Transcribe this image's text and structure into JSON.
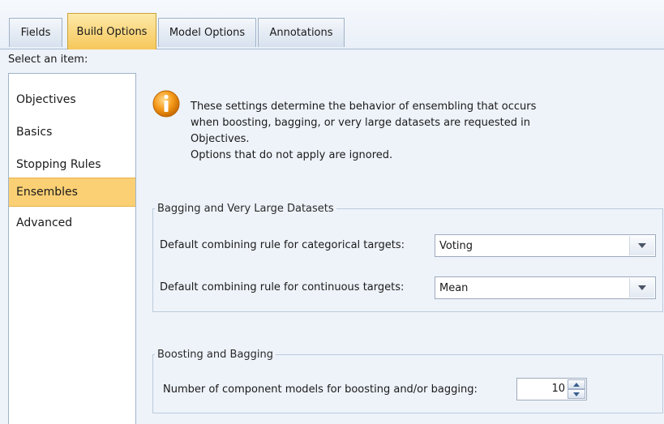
{
  "tabs": [
    {
      "label": "Fields",
      "active": false
    },
    {
      "label": "Build Options",
      "active": true
    },
    {
      "label": "Model Options",
      "active": false
    },
    {
      "label": "Annotations",
      "active": false
    }
  ],
  "select_label": "Select an item:",
  "items": [
    {
      "label": "Objectives",
      "selected": false
    },
    {
      "label": "Basics",
      "selected": false
    },
    {
      "label": "Stopping Rules",
      "selected": false
    },
    {
      "label": "Ensembles",
      "selected": true
    },
    {
      "label": "Advanced",
      "selected": false
    }
  ],
  "info": {
    "icon": "info-icon",
    "lines": [
      "These settings determine the behavior of ensembling that occurs",
      "when boosting, bagging, or very large datasets are requested in",
      "Objectives.",
      "Options that do not apply are ignored."
    ]
  },
  "bagging_group": {
    "legend": "Bagging and Very Large Datasets",
    "categorical_label": "Default combining rule for categorical targets:",
    "categorical_value": "Voting",
    "continuous_label": "Default combining rule for continuous targets:",
    "continuous_value": "Mean"
  },
  "boosting_group": {
    "legend": "Boosting and Bagging",
    "component_label": "Number of component models for boosting and/or bagging:",
    "component_value": "10"
  },
  "colors": {
    "active_tab": "#f6c75a",
    "selected_item": "#fbd074",
    "background": "#eef3fa"
  }
}
